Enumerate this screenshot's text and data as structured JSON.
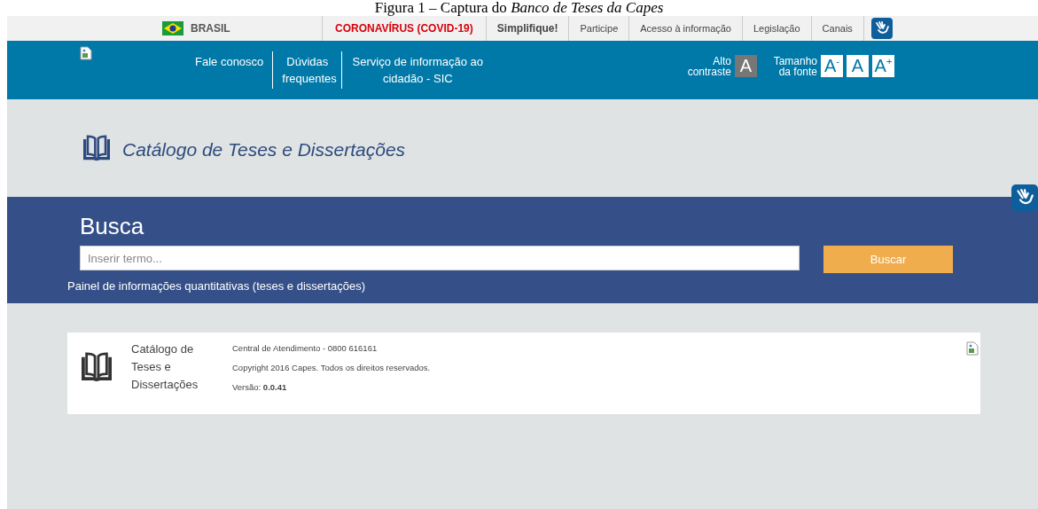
{
  "caption": "Figura 1 – Captura do *Banco de Teses da Capes*",
  "gov_bar": {
    "country": "BRASIL",
    "links": [
      {
        "label": "CORONAVÍRUS (COVID-19)",
        "kind": "alert"
      },
      {
        "label": "Simplifique!",
        "kind": "bold"
      },
      {
        "label": "Participe",
        "kind": "normal"
      },
      {
        "label": "Acesso à informação",
        "kind": "normal"
      },
      {
        "label": "Legislação",
        "kind": "normal"
      },
      {
        "label": "Canais",
        "kind": "normal"
      }
    ]
  },
  "header": {
    "nav": [
      "Fale conosco",
      "Dúvidas frequentes",
      "Serviço de informação ao cidadão - SIC"
    ],
    "contrast": {
      "label": "Alto contraste",
      "button": "A"
    },
    "font_size": {
      "label": "Tamanho da fonte",
      "buttons": [
        "A$^{-}$",
        "A",
        "A$^{+}$"
      ]
    }
  },
  "title": "Catálogo de Teses e Dissertações",
  "search": {
    "heading": "Busca",
    "placeholder": "Inserir termo...",
    "button": "Buscar",
    "link": "Painel de informações quantitativas (teses e dissertações)"
  },
  "footer": {
    "title": "Catálogo de Teses e Dissertações",
    "lines": [
      "Central de Atendimento - 0800 616161",
      "Copyright 2016 Capes. Todos os direitos reservados.",
      "Versão: **0.0.41**"
    ]
  }
}
